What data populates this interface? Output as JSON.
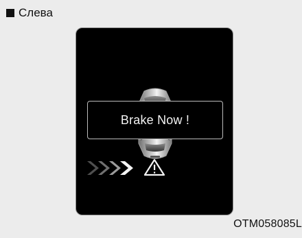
{
  "header": {
    "title": "Слева"
  },
  "display": {
    "message": "Brake Now !"
  },
  "footer": {
    "code": "OTM058085L"
  },
  "icons": {
    "bullet": "square-bullet-icon",
    "vehicle": "car-top-view-icon",
    "approach": "approach-chevrons-icon",
    "warning": "warning-triangle-icon"
  },
  "colors": {
    "background": "#ececec",
    "screen": "#000000",
    "text": "#111111",
    "message_text": "#f2f2f2",
    "frame_border": "#8f8f8f",
    "message_border": "#bdbdbd"
  }
}
